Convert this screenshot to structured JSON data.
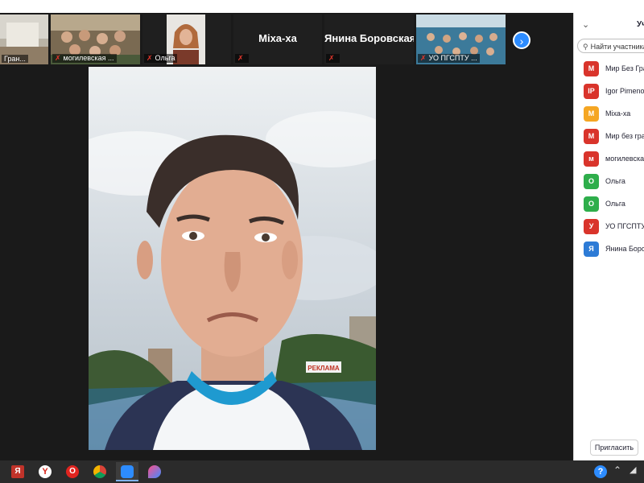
{
  "thumbnails": [
    {
      "name": "Гран...",
      "muted": false
    },
    {
      "name": "могилевская ...",
      "muted": true
    },
    {
      "name": "Ольга",
      "muted": true
    },
    {
      "name": "Міха-ха",
      "muted": true
    },
    {
      "name": "Янина Боровская",
      "muted": true
    },
    {
      "name": "УО ПГСПТУ ...",
      "muted": true
    }
  ],
  "panel": {
    "title": "Уч",
    "search_placeholder": "Найти участника",
    "invite_label": "Пригласить",
    "participants": [
      {
        "initial": "М",
        "name": "Мир Без Гра",
        "color": "#d9342b"
      },
      {
        "initial": "IP",
        "name": "Igor Pimenov",
        "color": "#d9342b"
      },
      {
        "initial": "М",
        "name": "Міха-ха",
        "color": "#f5a623"
      },
      {
        "initial": "М",
        "name": "Мир без гра",
        "color": "#d9342b"
      },
      {
        "initial": "м",
        "name": "могилевская",
        "color": "#d9342b"
      },
      {
        "initial": "О",
        "name": "Ольга",
        "color": "#2eae4b"
      },
      {
        "initial": "О",
        "name": "Ольга",
        "color": "#2eae4b"
      },
      {
        "initial": "У",
        "name": "УО ПГСПТУ",
        "color": "#d9342b"
      },
      {
        "initial": "Я",
        "name": "Янина Боров",
        "color": "#2d7bd6"
      }
    ]
  },
  "video": {
    "sign_text": "РЕКЛАМА"
  },
  "taskbar": {
    "apps": [
      {
        "icon": "yandex-icon",
        "label": "Я"
      },
      {
        "icon": "yandex-browser-icon",
        "label": "Y"
      },
      {
        "icon": "opera-icon",
        "label": "O"
      },
      {
        "icon": "chrome-icon",
        "label": ""
      },
      {
        "icon": "zoom-icon",
        "label": ""
      },
      {
        "icon": "drop-app-icon",
        "label": ""
      }
    ],
    "tray_help": "?",
    "tray_chevron": "⌃"
  },
  "colors": {
    "accent": "#2d8cff",
    "muted_mic": "#e0362c",
    "panel_bg": "#ffffff"
  }
}
